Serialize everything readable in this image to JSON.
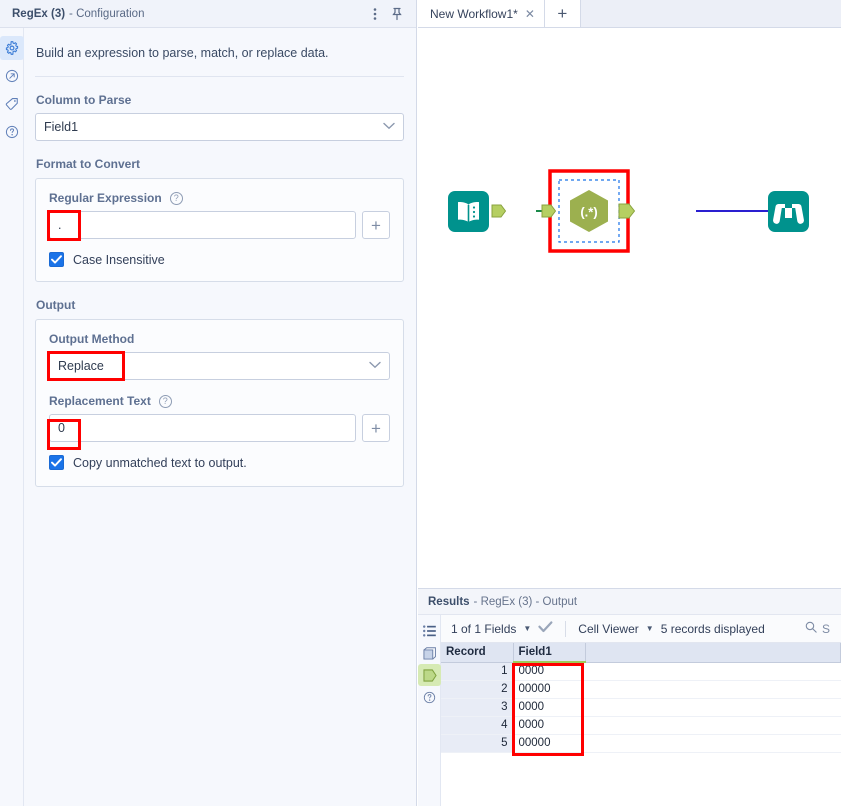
{
  "config": {
    "header": {
      "title_strong": "RegEx (3)",
      "title_rest": "- Configuration",
      "menu_icon": "vertical-dots-icon",
      "pin_icon": "pin-icon"
    },
    "rail": [
      {
        "icon": "gear-icon",
        "active": true
      },
      {
        "icon": "arrow-in-circle-icon",
        "active": false
      },
      {
        "icon": "tag-icon",
        "active": false
      },
      {
        "icon": "question-circle-icon",
        "active": false
      }
    ],
    "intro": "Build an expression to parse, match, or replace data.",
    "column_to_parse": {
      "label": "Column to Parse",
      "value": "Field1"
    },
    "format_to_convert": {
      "label": "Format to Convert",
      "regex": {
        "label": "Regular Expression",
        "help_icon": "question-circle-icon",
        "value": ".",
        "placeholder": "",
        "add_label": "+"
      },
      "case_insensitive": {
        "label": "Case Insensitive",
        "checked": true
      }
    },
    "output": {
      "label": "Output",
      "output_method": {
        "label": "Output Method",
        "value": "Replace"
      },
      "replacement_text": {
        "label": "Replacement Text",
        "help_icon": "question-circle-icon",
        "value": "0",
        "placeholder": "",
        "add_label": "+"
      },
      "copy_unmatched": {
        "label": "Copy unmatched text to output.",
        "checked": true
      }
    }
  },
  "tabbar": {
    "tab_label": "New Workflow1*",
    "close_icon": "close-icon",
    "add_label": "+"
  },
  "canvas": {
    "nodes": [
      {
        "name": "input-node",
        "icon": "book-icon",
        "color": "#00928d"
      },
      {
        "name": "regex-node",
        "icon": "regex-hexagon-icon",
        "label": "(.*)",
        "color": "#9cb04f",
        "selected": true
      },
      {
        "name": "browse-node",
        "icon": "binoculars-icon",
        "color": "#00928d"
      }
    ],
    "connections": [
      {
        "from": "input-node",
        "to": "regex-node",
        "color": "#1b8a4a"
      },
      {
        "from": "regex-node",
        "to": "browse-node",
        "color": "#2a1fd0"
      }
    ]
  },
  "results": {
    "header": {
      "title_strong": "Results",
      "title_rest": "- RegEx (3) - Output"
    },
    "rail": [
      {
        "icon": "list-icon",
        "active": false
      },
      {
        "icon": "panel-icon",
        "active": false
      },
      {
        "icon": "green-pentagon-icon",
        "active": true
      },
      {
        "icon": "question-circle-icon",
        "active": false
      }
    ],
    "toolbar": {
      "fields_label": "1 of 1 Fields",
      "caret": "▼",
      "check_icon": "checkmark-icon",
      "cell_viewer_label": "Cell Viewer",
      "records_label": "5 records displayed",
      "search_icon": "search-icon",
      "search_placeholder": "S"
    },
    "table": {
      "columns": [
        "Record",
        "Field1"
      ],
      "rows": [
        {
          "record": "1",
          "field1": "0000"
        },
        {
          "record": "2",
          "field1": "00000"
        },
        {
          "record": "3",
          "field1": "0000"
        },
        {
          "record": "4",
          "field1": "0000"
        },
        {
          "record": "5",
          "field1": "00000"
        }
      ]
    }
  },
  "annotations": {
    "highlight_color": "#ff0000"
  }
}
